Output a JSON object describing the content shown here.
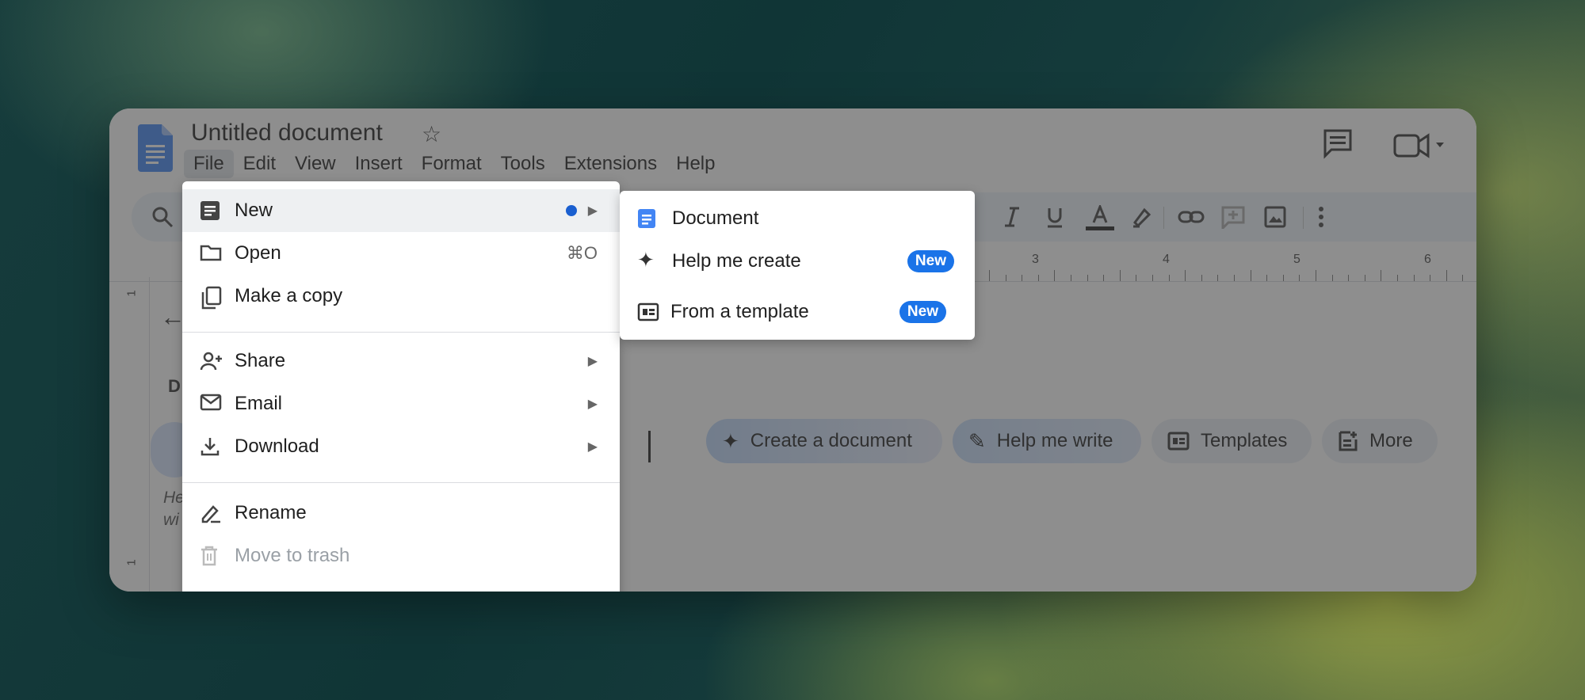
{
  "document": {
    "title": "Untitled document"
  },
  "menubar": [
    {
      "label": "File"
    },
    {
      "label": "Edit"
    },
    {
      "label": "View"
    },
    {
      "label": "Insert"
    },
    {
      "label": "Format"
    },
    {
      "label": "Tools"
    },
    {
      "label": "Extensions"
    },
    {
      "label": "Help"
    }
  ],
  "ruler": {
    "numbers": [
      "3",
      "4",
      "5",
      "6"
    ]
  },
  "left_ruler": {
    "numbers": [
      "1",
      "1"
    ]
  },
  "page": {
    "partial_heading": "D",
    "partial_italic": "He wi"
  },
  "chips": {
    "create": "Create a document",
    "write": "Help me write",
    "templates": "Templates",
    "more": "More"
  },
  "file_menu": {
    "new": "New",
    "open": "Open",
    "open_shortcut": "⌘O",
    "make_copy": "Make a copy",
    "share": "Share",
    "email": "Email",
    "download": "Download",
    "rename": "Rename",
    "trash": "Move to trash"
  },
  "new_submenu": {
    "document": "Document",
    "help_me_create": "Help me create",
    "from_template": "From a template",
    "badge": "New"
  },
  "colors": {
    "accent": "#1a73e8",
    "docs_blue": "#4285f4"
  }
}
